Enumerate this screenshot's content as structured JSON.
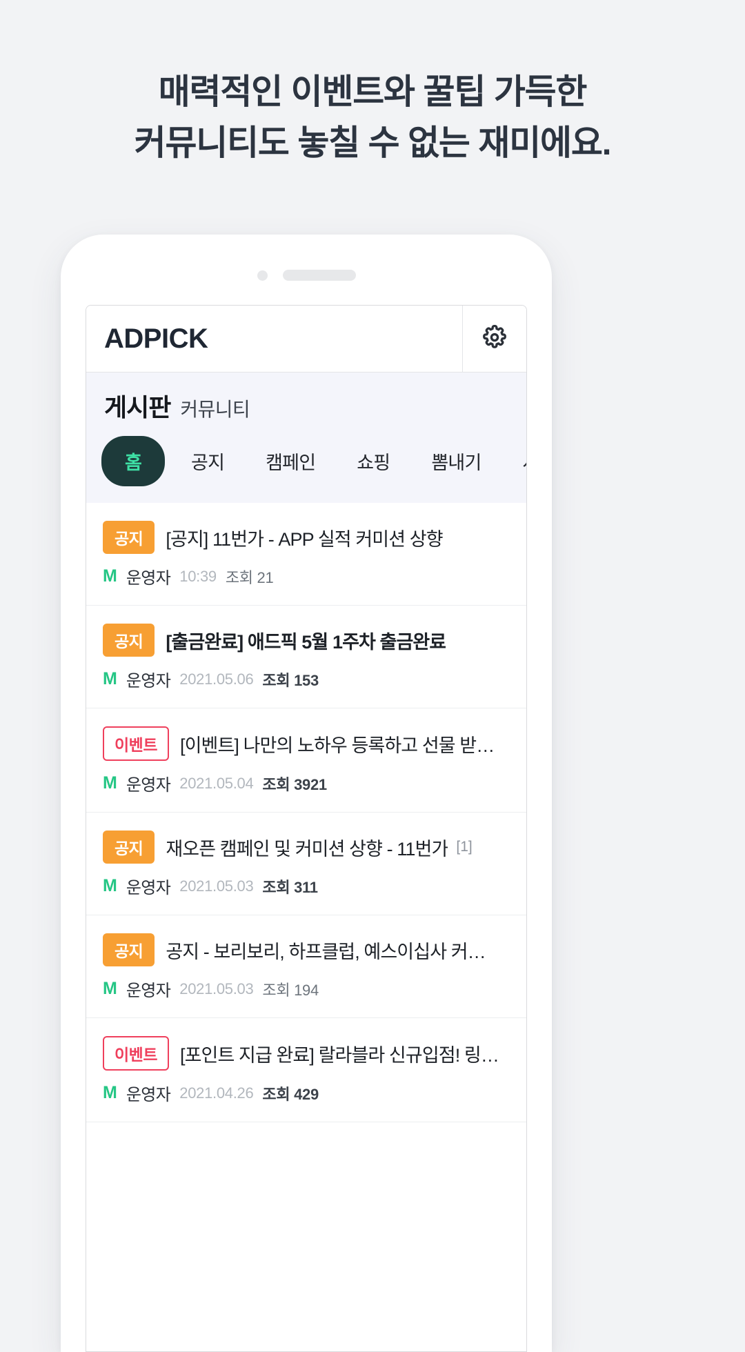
{
  "headline": {
    "line1": "매력적인 이벤트와 꿀팁 가득한",
    "line2": "커뮤니티도 놓칠 수 없는 재미에요."
  },
  "app": {
    "brand": "ADPICK",
    "settings_icon": "gear-icon"
  },
  "board": {
    "title": "게시판",
    "subtitle": "커뮤니티"
  },
  "tabs": [
    {
      "label": "홈",
      "active": true
    },
    {
      "label": "공지",
      "active": false
    },
    {
      "label": "캠페인",
      "active": false
    },
    {
      "label": "쇼핑",
      "active": false
    },
    {
      "label": "뽐내기",
      "active": false
    },
    {
      "label": "사고팔고",
      "active": false
    }
  ],
  "posts": [
    {
      "badge": "공지",
      "badge_type": "notice",
      "title": "[공지] 11번가 - APP 실적 커미션 상향",
      "title_bold": false,
      "comments": "",
      "author_mark": "M",
      "author": "운영자",
      "date": "10:39",
      "views": "조회 21",
      "views_strong": false
    },
    {
      "badge": "공지",
      "badge_type": "notice",
      "title": "[출금완료] 애드픽 5월 1주차 출금완료",
      "title_bold": true,
      "comments": "",
      "author_mark": "M",
      "author": "운영자",
      "date": "2021.05.06",
      "views": "조회 153",
      "views_strong": true
    },
    {
      "badge": "이벤트",
      "badge_type": "event",
      "title": "[이벤트] 나만의 노하우 등록하고 선물 받자! 노하우…",
      "title_bold": false,
      "comments": "",
      "author_mark": "M",
      "author": "운영자",
      "date": "2021.05.04",
      "views": "조회 3921",
      "views_strong": true
    },
    {
      "badge": "공지",
      "badge_type": "notice",
      "title": "재오픈 캠페인 및 커미션 상향 - 11번가",
      "title_bold": false,
      "comments": "[1]",
      "author_mark": "M",
      "author": "운영자",
      "date": "2021.05.03",
      "views": "조회 311",
      "views_strong": true
    },
    {
      "badge": "공지",
      "badge_type": "notice",
      "title": "공지 - 보리보리, 하프클럽, 예스이십사 커미션 이벤트…",
      "title_bold": false,
      "comments": "",
      "author_mark": "M",
      "author": "운영자",
      "date": "2021.05.03",
      "views": "조회 194",
      "views_strong": false
    },
    {
      "badge": "이벤트",
      "badge_type": "event",
      "title": "[포인트 지급 완료] 랄라블라 신규입점! 링크 인증하…",
      "title_bold": false,
      "comments": "",
      "author_mark": "M",
      "author": "운영자",
      "date": "2021.04.26",
      "views": "조회 429",
      "views_strong": true
    }
  ],
  "colors": {
    "page_bg": "#f2f3f5",
    "headline": "#2c3440",
    "brand": "#1f2733",
    "board_bg": "#f4f5fb",
    "tab_active_bg": "#1d3a3a",
    "tab_active_text": "#3ee0a5",
    "badge_notice": "#f79f33",
    "badge_event": "#ef3f5c",
    "author_mark": "#25c685"
  }
}
